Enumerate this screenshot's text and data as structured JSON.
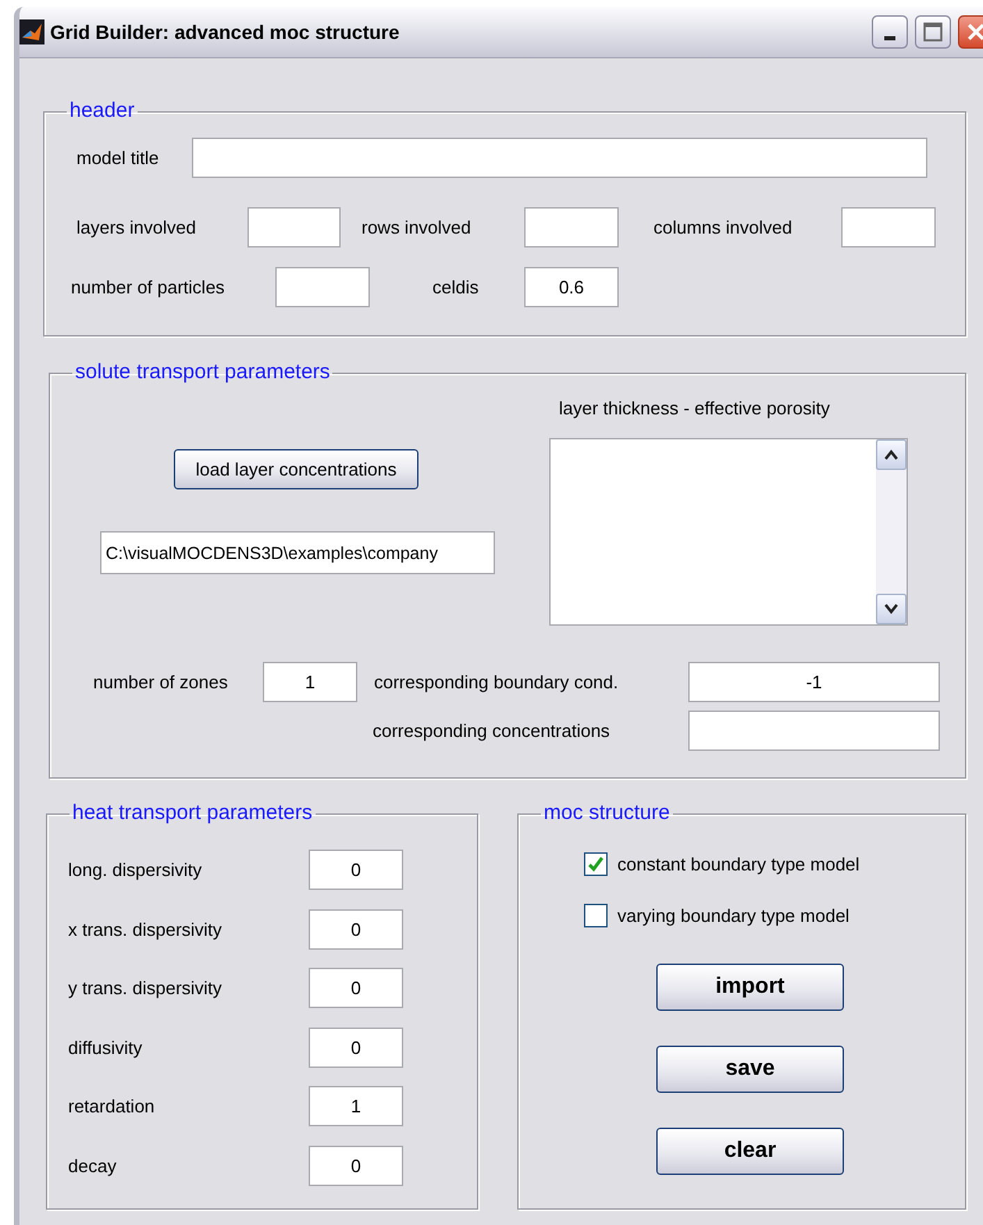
{
  "window": {
    "title": "Grid Builder: advanced moc structure"
  },
  "header": {
    "legend": "header",
    "fields": [
      {
        "label": "model title"
      },
      {
        "label": "layers involved"
      },
      {
        "label": "rows involved"
      },
      {
        "label": "columns involved"
      },
      {
        "label": "number of particles"
      },
      {
        "label": "celdis",
        "value": "0.6"
      }
    ]
  },
  "solute": {
    "legend": "solute transport parameters",
    "list_label": "layer thickness - effective porosity",
    "load_button": "load layer concentrations",
    "path": "C:\\visualMOCDENS3D\\examples\\company",
    "fields": [
      {
        "label": "number of zones",
        "value": "1"
      },
      {
        "label": "corresponding boundary cond.",
        "value": "-1"
      },
      {
        "label": "corresponding concentrations"
      }
    ]
  },
  "heat": {
    "legend": "heat transport parameters",
    "fields": [
      {
        "label": "long. dispersivity",
        "value": "0"
      },
      {
        "label": "x trans. dispersivity",
        "value": "0"
      },
      {
        "label": "y trans. dispersivity",
        "value": "0"
      },
      {
        "label": "diffusivity",
        "value": "0"
      },
      {
        "label": "retardation",
        "value": "1"
      },
      {
        "label": "decay",
        "value": "0"
      }
    ]
  },
  "moc": {
    "legend": "moc structure",
    "checkboxes": [
      {
        "label": "constant boundary type model",
        "checked": true
      },
      {
        "label": "varying boundary type model",
        "checked": false
      }
    ],
    "buttons": [
      "import",
      "save",
      "clear"
    ]
  }
}
